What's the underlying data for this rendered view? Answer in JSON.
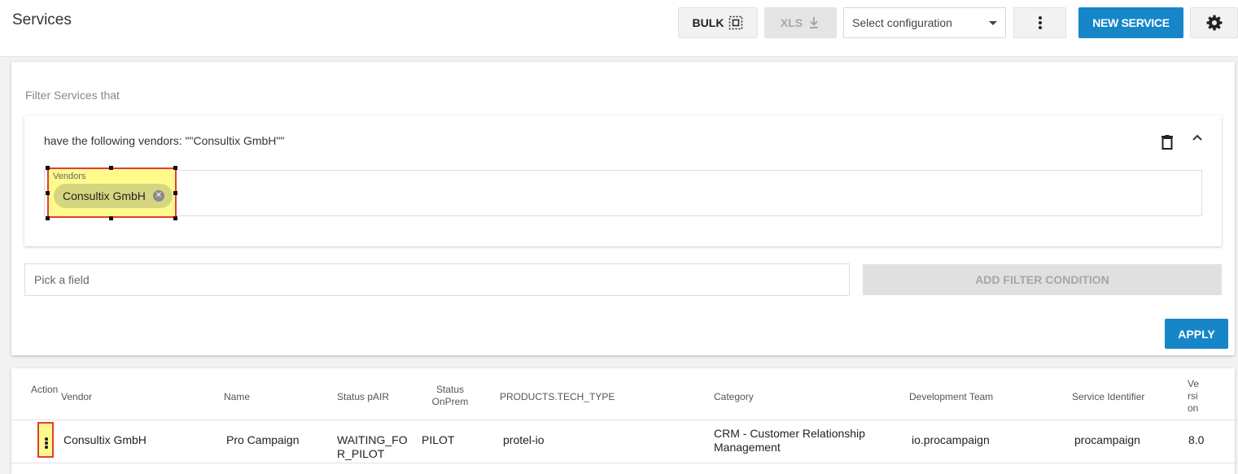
{
  "header": {
    "title": "Services",
    "bulk_label": "BULK",
    "xls_label": "XLS",
    "config_select": "Select configuration",
    "new_service_label": "NEW SERVICE"
  },
  "icons": [
    "select-all-icon",
    "download-icon",
    "chevron-down-icon",
    "more-vert-icon",
    "gear-icon",
    "trash-icon",
    "chevron-up-icon",
    "cancel-chip-icon"
  ],
  "colors": {
    "primary": "#1686c9",
    "highlight": "#fefa8c",
    "highlight_border": "#e23c3c"
  },
  "filter": {
    "title": "Filter Services that",
    "condition_text": "have the following vendors: \"\"Consultix GmbH\"\"",
    "field_label": "Vendors",
    "chip": "Consultix GmbH",
    "pick_placeholder": "Pick a field",
    "add_condition_label": "ADD FILTER CONDITION",
    "apply_label": "APPLY"
  },
  "table": {
    "columns": {
      "action": "Action",
      "vendor": "Vendor",
      "name": "Name",
      "status_pair": "Status pAIR",
      "status_onprem": "Status OnPrem",
      "tech_type": "PRODUCTS.TECH_TYPE",
      "category": "Category",
      "dev_team": "Development Team",
      "service_id": "Service Identifier",
      "version": "Version"
    },
    "rows": [
      {
        "vendor": "Consultix GmbH",
        "name": "Pro Campaign",
        "status_pair": "WAITING_FOR_PILOT",
        "status_onprem": "PILOT",
        "tech_type": "protel-io",
        "category": "CRM - Customer Relationship Management",
        "dev_team": "io.procampaign",
        "service_id": "procampaign",
        "version": "8.0"
      }
    ]
  }
}
